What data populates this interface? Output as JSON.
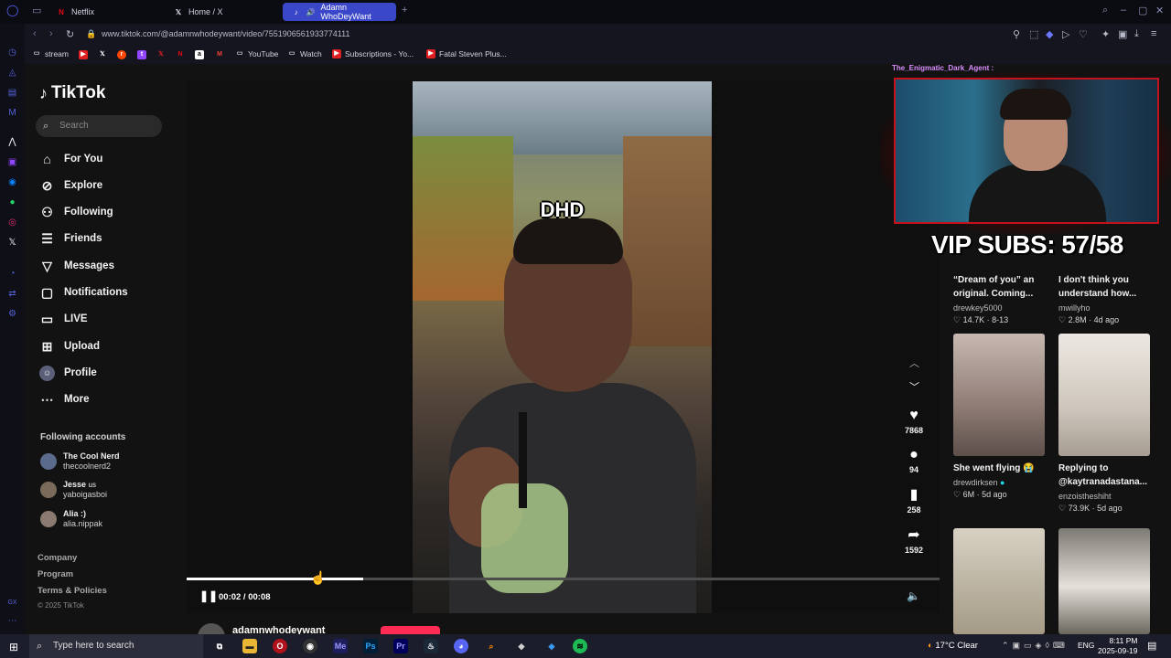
{
  "browser": {
    "tabs": [
      {
        "label": "Netflix",
        "icon": "netflix-icon",
        "active": false
      },
      {
        "label": "Home / X",
        "icon": "x-icon",
        "active": false
      },
      {
        "label": "Adamn WhoDeyWant",
        "icon": "tiktok-icon",
        "active": true
      }
    ],
    "url": "www.tiktok.com/@adamnwhodeywant/video/7551906561933774111",
    "bookmarks": [
      {
        "label": "stream",
        "icon": "folder-icon"
      },
      {
        "label": "YouTube",
        "icon": "folder-icon"
      },
      {
        "label": "Watch",
        "icon": "folder-icon"
      },
      {
        "label": "Subscriptions - Yo...",
        "icon": "youtube-icon"
      },
      {
        "label": "Fatal Steven Plus...",
        "icon": "youtube-icon"
      }
    ]
  },
  "tiktok": {
    "logo_text": "TikTok",
    "search_placeholder": "Search",
    "nav": [
      {
        "label": "For You",
        "icon": "home-icon"
      },
      {
        "label": "Explore",
        "icon": "compass-icon"
      },
      {
        "label": "Following",
        "icon": "following-icon"
      },
      {
        "label": "Friends",
        "icon": "friends-icon"
      },
      {
        "label": "Messages",
        "icon": "messages-icon"
      },
      {
        "label": "Notifications",
        "icon": "bell-icon"
      },
      {
        "label": "LIVE",
        "icon": "live-icon"
      },
      {
        "label": "Upload",
        "icon": "upload-icon"
      },
      {
        "label": "Profile",
        "icon": "avatar-icon"
      },
      {
        "label": "More",
        "icon": "more-icon"
      }
    ],
    "following_title": "Following accounts",
    "following": [
      {
        "name": "The Cool Nerd",
        "handle": "thecoolnerd2"
      },
      {
        "name": "Jesse",
        "sub": "us",
        "handle": "yaboigasboi"
      },
      {
        "name": "Alia :)",
        "handle": "alia.nippak"
      }
    ],
    "footer": [
      "Company",
      "Program",
      "Terms & Policies"
    ],
    "copyright": "© 2025 TikTok"
  },
  "video": {
    "overlay_text": "DHD",
    "current_time": "00:02",
    "duration": "00:08",
    "time_label": "00:02 / 00:08",
    "progress": 0.235,
    "likes": "7868",
    "comments": "94",
    "saves": "258",
    "shares": "1592",
    "author": "adamnwhodeywant"
  },
  "recommended": [
    {
      "title": "“Dream of you” an original. Coming...",
      "user": "drewkey5000",
      "views": "14.7K",
      "date": "8-13",
      "thumb": "#3a3a46"
    },
    {
      "title": "I don't think you understand how...",
      "user": "mwillyho",
      "views": "2.8M",
      "date": "4d ago",
      "thumb": "#3a3a46"
    },
    {
      "title": "She went flying 😭",
      "user": "drewdirksen",
      "views": "6M",
      "date": "5d ago",
      "thumb": "#b9a9a2"
    },
    {
      "title": "Replying to @kaytranadastana...",
      "user": "enzoistheshiht",
      "views": "73.9K",
      "date": "5d ago",
      "thumb": "#d9d5cf"
    },
    {
      "title": "",
      "user": "",
      "views": "",
      "date": "",
      "thumb": "#bdb6a8"
    },
    {
      "title": "",
      "user": "",
      "views": "",
      "date": "",
      "thumb": "#9b9892"
    }
  ],
  "stream": {
    "cam_user": "The_Enigmatic_Dark_Agent :",
    "vip_text": "VIP SUBS: 57/58"
  },
  "taskbar": {
    "search_placeholder": "Type here to search",
    "weather": "17°C  Clear",
    "lang": "ENG",
    "time": "8:11 PM",
    "date": "2025-09-19"
  },
  "colors": {
    "accent": "#fe2c55",
    "tab_active": "#3b47c9",
    "webcam_border": "#c4121c"
  }
}
